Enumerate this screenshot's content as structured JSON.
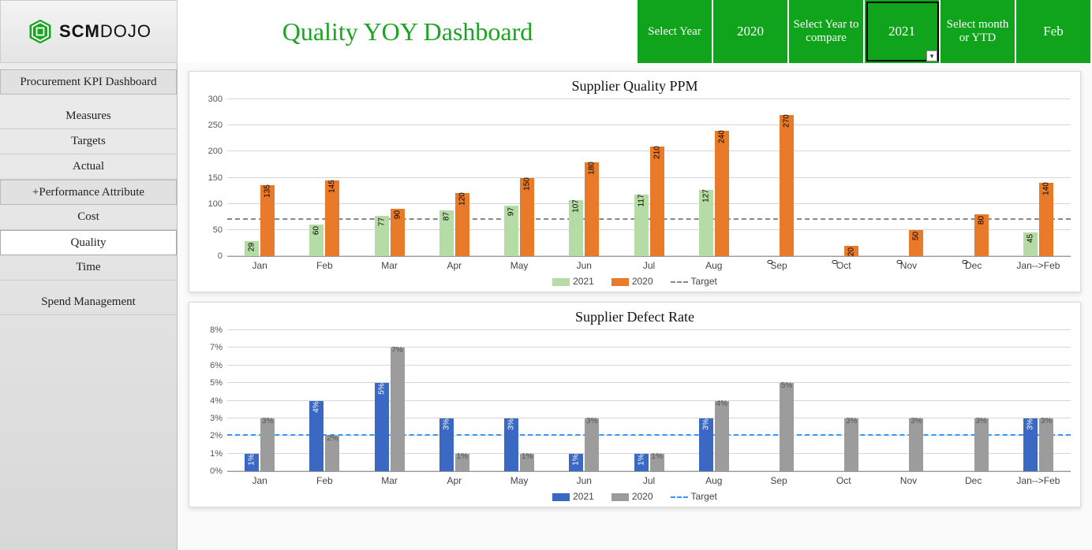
{
  "brand": {
    "name_part1": "SCM",
    "name_part2": "DOJO"
  },
  "title": "Quality  YOY Dashboard",
  "selectors": {
    "select_year_label": "Select Year",
    "select_year_value": "2020",
    "compare_label": "Select Year to compare",
    "compare_value": "2021",
    "month_label": "Select month or YTD",
    "month_value": "Feb"
  },
  "sidebar": {
    "header": "Procurement KPI Dashboard",
    "items": [
      "Measures",
      "Targets",
      "Actual"
    ],
    "perf_header": "+Performance Attribute",
    "perf_items": [
      "Cost",
      "Quality",
      "Time"
    ],
    "spend": "Spend Management",
    "active": "Quality"
  },
  "chart_data": [
    {
      "type": "bar",
      "title": "Supplier Quality PPM",
      "categories": [
        "Jan",
        "Feb",
        "Mar",
        "Apr",
        "May",
        "Jun",
        "Jul",
        "Aug",
        "Sep",
        "Oct",
        "Nov",
        "Dec",
        "Jan-->Feb"
      ],
      "series": [
        {
          "name": "2021",
          "values": [
            29,
            60,
            77,
            87,
            97,
            107,
            117,
            127,
            0,
            0,
            0,
            0,
            45
          ],
          "labels": [
            "29",
            "60",
            "77",
            "87",
            "97",
            "107",
            "117",
            "127",
            "0",
            "0",
            "0",
            "0",
            "45"
          ]
        },
        {
          "name": "2020",
          "values": [
            135,
            145,
            90,
            120,
            150,
            180,
            210,
            240,
            270,
            20,
            50,
            80,
            140
          ],
          "labels": [
            "135",
            "145",
            "90",
            "120",
            "150",
            "180",
            "210",
            "240",
            "270",
            "20",
            "50",
            "80",
            "140"
          ]
        }
      ],
      "ylim": [
        0,
        300
      ],
      "yticks": [
        0,
        50,
        100,
        150,
        200,
        250,
        300
      ],
      "target": 70,
      "legend": [
        "2021",
        "2020",
        "Target"
      ]
    },
    {
      "type": "bar",
      "title": "Supplier Defect Rate",
      "categories": [
        "Jan",
        "Feb",
        "Mar",
        "Apr",
        "May",
        "Jun",
        "Jul",
        "Aug",
        "Sep",
        "Oct",
        "Nov",
        "Dec",
        "Jan-->Feb"
      ],
      "series": [
        {
          "name": "2021",
          "values": [
            1,
            4,
            5,
            3,
            3,
            1,
            1,
            3,
            0,
            0,
            0,
            0,
            3
          ],
          "labels": [
            "1%",
            "4%",
            "5%",
            "3%",
            "3%",
            "1%",
            "1%",
            "3%",
            "",
            "",
            "",
            "",
            "3%"
          ]
        },
        {
          "name": "2020",
          "values": [
            3,
            2,
            7,
            1,
            1,
            3,
            1,
            4,
            5,
            3,
            3,
            3,
            3
          ],
          "labels": [
            "3%",
            "2%",
            "7%",
            "1%",
            "1%",
            "3%",
            "1%",
            "4%",
            "5%",
            "3%",
            "3%",
            "3%",
            "3%"
          ]
        }
      ],
      "ylim": [
        0,
        8
      ],
      "yticks": [
        0,
        1,
        2,
        3,
        4,
        5,
        6,
        7,
        8
      ],
      "ytick_labels": [
        "0%",
        "1%",
        "2%",
        "3%",
        "4%",
        "5%",
        "6%",
        "7%",
        "8%"
      ],
      "target": 2,
      "legend": [
        "2021",
        "2020",
        "Target"
      ]
    }
  ]
}
